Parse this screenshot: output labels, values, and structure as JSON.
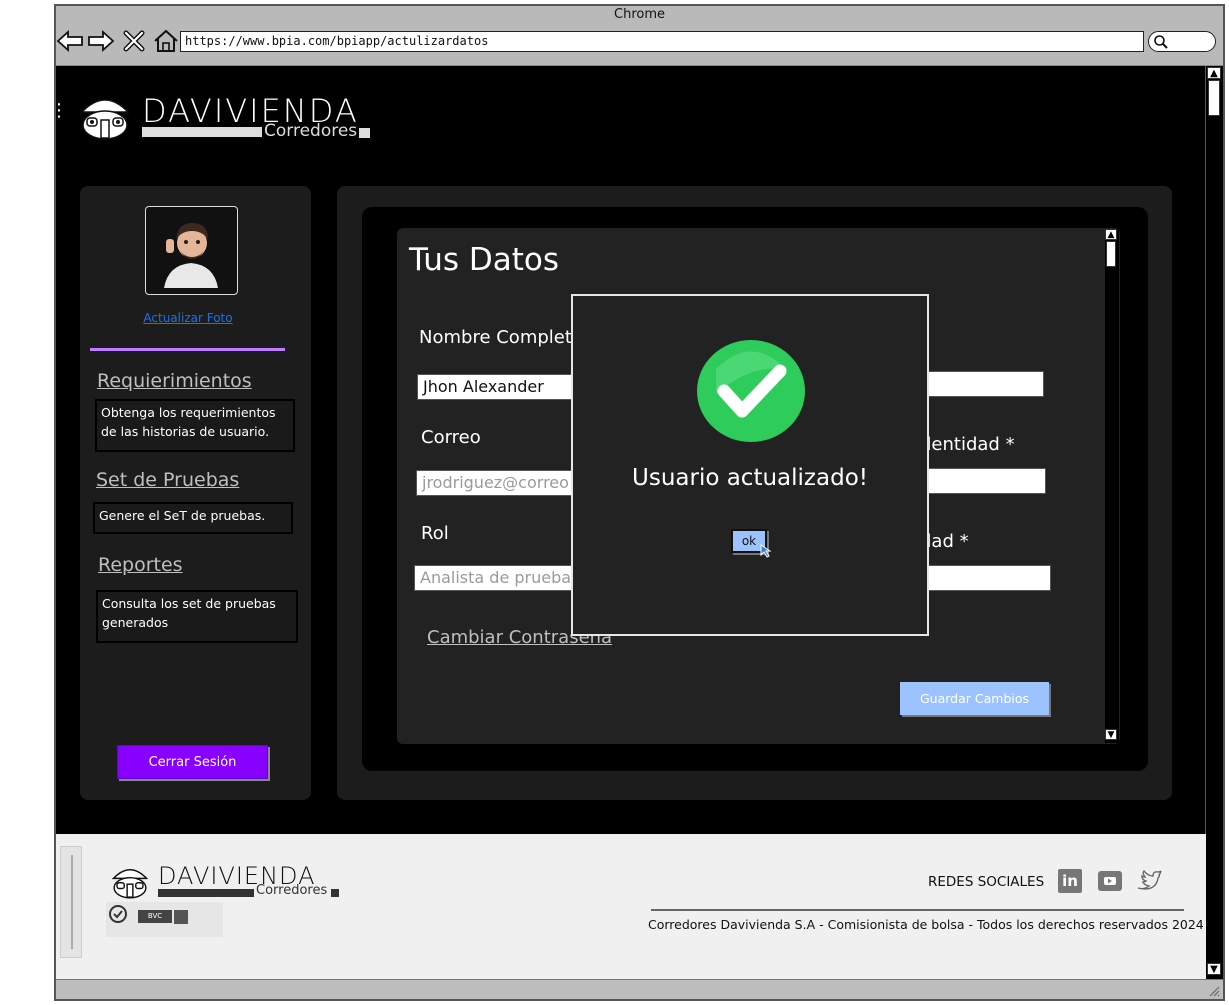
{
  "browser": {
    "title": "Chrome",
    "url": "https://www.bpia.com/bpiapp/actulizardatos"
  },
  "logo": {
    "brand": "DAVIVIENDA",
    "sub": "Corredores"
  },
  "sidebar": {
    "update_photo": "Actualizar Foto",
    "items": [
      {
        "title": "Requierimientos",
        "desc": "Obtenga los requerimientos de las historias de usuario."
      },
      {
        "title": "Set de Pruebas",
        "desc": "Genere el SeT de pruebas."
      },
      {
        "title": "Reportes",
        "desc": "Consulta los set de pruebas generados"
      }
    ],
    "logout": "Cerrar Sesión"
  },
  "form": {
    "heading": "Tus Datos",
    "name_label": "Nombre Completo",
    "name_value": "Jhon Alexander",
    "email_label": "Correo",
    "email_value": "jrodriguez@correo",
    "role_label": "Rol",
    "role_value": "Analista de pruebas",
    "id_label_right": "dentidad *",
    "city_label_right": "dad *",
    "change_password": "Cambiar Contraseña",
    "save": "Guardar Cambios"
  },
  "modal": {
    "message": "Usuario actualizado!",
    "ok": "ok"
  },
  "footer": {
    "social_label": "REDES SOCIALES",
    "copyright": "Corredores Davivienda S.A - Comisionista de bolsa - Todos los derechos reservados 2024",
    "badge": "BVC"
  },
  "colors": {
    "accent_purple": "#8800ff",
    "button_blue": "#9dc3ff",
    "success_green": "#2ecc5a"
  }
}
